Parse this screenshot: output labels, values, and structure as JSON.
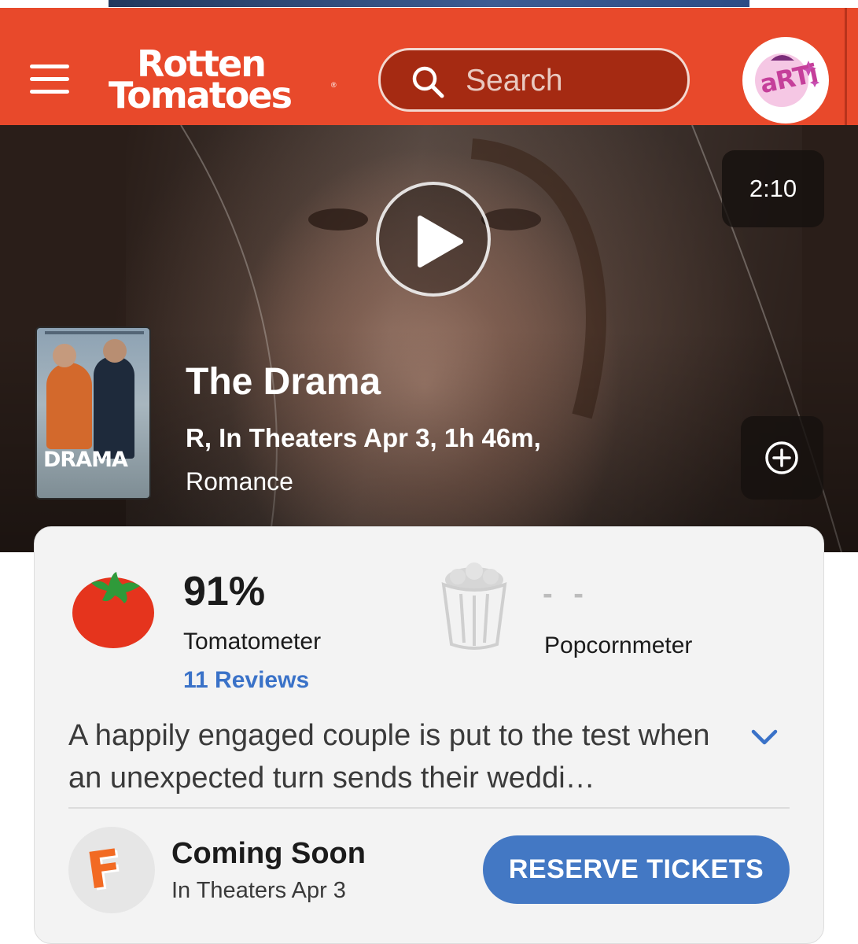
{
  "header": {
    "logo_line1": "Rotten",
    "logo_line2": "Tomatoes",
    "logo_mark": "®",
    "search_placeholder": "Search",
    "avatar_text": "aRTi",
    "brand_color": "#e8492b"
  },
  "trailer": {
    "duration": "2:10",
    "play_icon": "play-icon"
  },
  "movie": {
    "title": "The Drama",
    "meta_line1": "R, In Theaters Apr 3, 1h 46m,",
    "meta_line2": "Romance",
    "poster_text": "DRAMA",
    "add_icon": "plus-circle-icon"
  },
  "scores": {
    "tomatometer_value": "91%",
    "tomatometer_label": "Tomatometer",
    "reviews_link": "11 Reviews",
    "popcornmeter_value": "- -",
    "popcornmeter_label": "Popcornmeter",
    "link_color": "#3a72c8"
  },
  "synopsis": {
    "text": "A happily engaged couple is put to the test when an unexpected turn sends their weddi…"
  },
  "tickets": {
    "status": "Coming Soon",
    "release": "In Theaters Apr 3",
    "button_label": "RESERVE TICKETS",
    "button_color": "#4378c4",
    "vendor_icon": "fandango-icon"
  }
}
